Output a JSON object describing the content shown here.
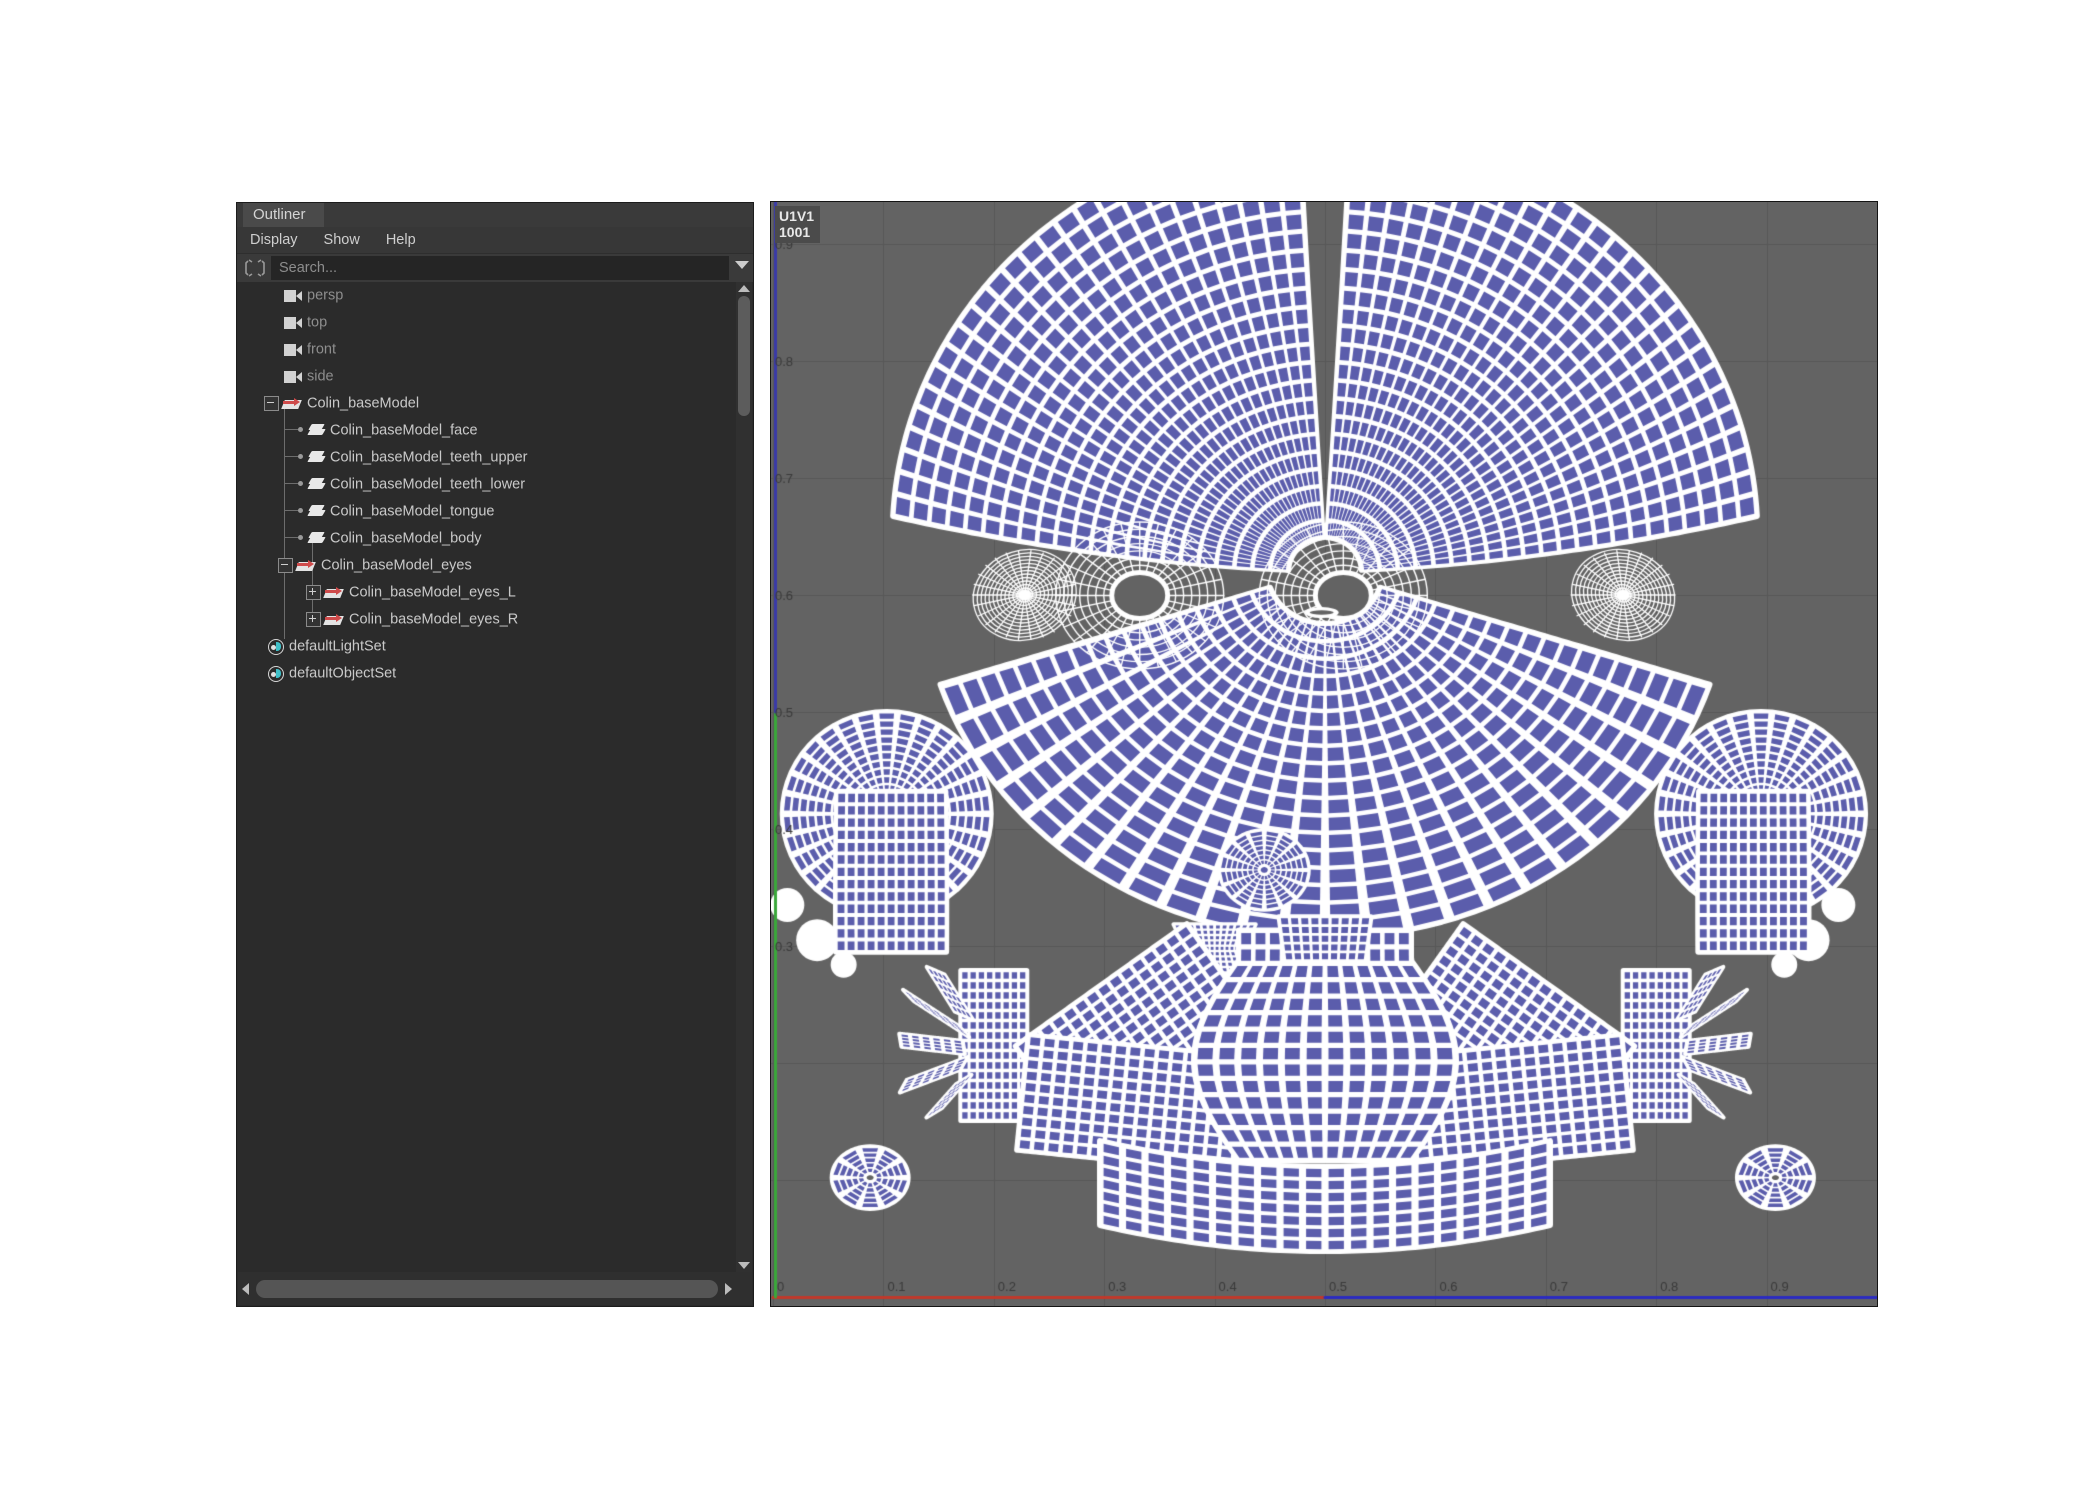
{
  "outliner": {
    "tab_label": "Outliner",
    "menus": [
      {
        "label": "Display"
      },
      {
        "label": "Show"
      },
      {
        "label": "Help"
      }
    ],
    "search": {
      "placeholder": "Search...",
      "value": "",
      "icon": "search-scope-icon",
      "dropdown_icon": "chevron-down-icon"
    },
    "tree": [
      {
        "label": "persp",
        "icon": "camera-icon",
        "indent": 1,
        "dim": true,
        "expander": "none",
        "connector": "none"
      },
      {
        "label": "top",
        "icon": "camera-icon",
        "indent": 1,
        "dim": true,
        "expander": "none",
        "connector": "none"
      },
      {
        "label": "front",
        "icon": "camera-icon",
        "indent": 1,
        "dim": true,
        "expander": "none",
        "connector": "none"
      },
      {
        "label": "side",
        "icon": "camera-icon",
        "indent": 1,
        "dim": true,
        "expander": "none",
        "connector": "none"
      },
      {
        "label": "Colin_baseModel",
        "icon": "transform-icon",
        "indent": 0,
        "dim": false,
        "expander": "minus",
        "connector": "none"
      },
      {
        "label": "Colin_baseModel_face",
        "icon": "mesh-icon",
        "indent": 1,
        "dim": false,
        "expander": "none",
        "connector": "dot"
      },
      {
        "label": "Colin_baseModel_teeth_upper",
        "icon": "mesh-icon",
        "indent": 1,
        "dim": false,
        "expander": "none",
        "connector": "dot"
      },
      {
        "label": "Colin_baseModel_teeth_lower",
        "icon": "mesh-icon",
        "indent": 1,
        "dim": false,
        "expander": "none",
        "connector": "dot"
      },
      {
        "label": "Colin_baseModel_tongue",
        "icon": "mesh-icon",
        "indent": 1,
        "dim": false,
        "expander": "none",
        "connector": "dot"
      },
      {
        "label": "Colin_baseModel_body",
        "icon": "mesh-icon",
        "indent": 1,
        "dim": false,
        "expander": "none",
        "connector": "dot"
      },
      {
        "label": "Colin_baseModel_eyes",
        "icon": "transform-icon",
        "indent": 1,
        "dim": false,
        "expander": "minus",
        "connector": "elbow"
      },
      {
        "label": "Colin_baseModel_eyes_L",
        "icon": "transform-icon",
        "indent": 2,
        "dim": false,
        "expander": "plus",
        "connector": "elbow"
      },
      {
        "label": "Colin_baseModel_eyes_R",
        "icon": "transform-icon",
        "indent": 2,
        "dim": false,
        "expander": "plus",
        "connector": "elbow"
      },
      {
        "label": "defaultLightSet",
        "icon": "set-icon",
        "indent": 0,
        "dim": false,
        "expander": "none",
        "connector": "none"
      },
      {
        "label": "defaultObjectSet",
        "icon": "set-icon",
        "indent": 0,
        "dim": false,
        "expander": "none",
        "connector": "none"
      }
    ],
    "scrollbars": {
      "vertical_up_icon": "triangle-up-icon",
      "vertical_down_icon": "triangle-down-icon",
      "horizontal_left_icon": "triangle-left-icon",
      "horizontal_right_icon": "triangle-right-icon"
    }
  },
  "uv_editor": {
    "tile_badge_line1": "U1V1",
    "tile_badge_line2": "1001",
    "u_ticks": [
      "0",
      "0.1",
      "0.2",
      "0.3",
      "0.4",
      "0.5",
      "0.6",
      "0.7",
      "0.8",
      "0.9"
    ],
    "v_ticks": [
      "0.3",
      "0.4",
      "0.5",
      "0.6",
      "0.7",
      "0.8",
      "0.9"
    ],
    "colors": {
      "background": "#636363",
      "grid_line": "#585858",
      "shell_fill": "#5b5dac",
      "shell_edge": "#ffffff",
      "u_axis_left": "#c0392b",
      "u_axis_right": "#2b2bc0",
      "v_axis_lower": "#3aa83a",
      "v_axis_upper": "#3a3aa8",
      "badge_bg": "#4b4b4b"
    },
    "shell_count": 22
  }
}
